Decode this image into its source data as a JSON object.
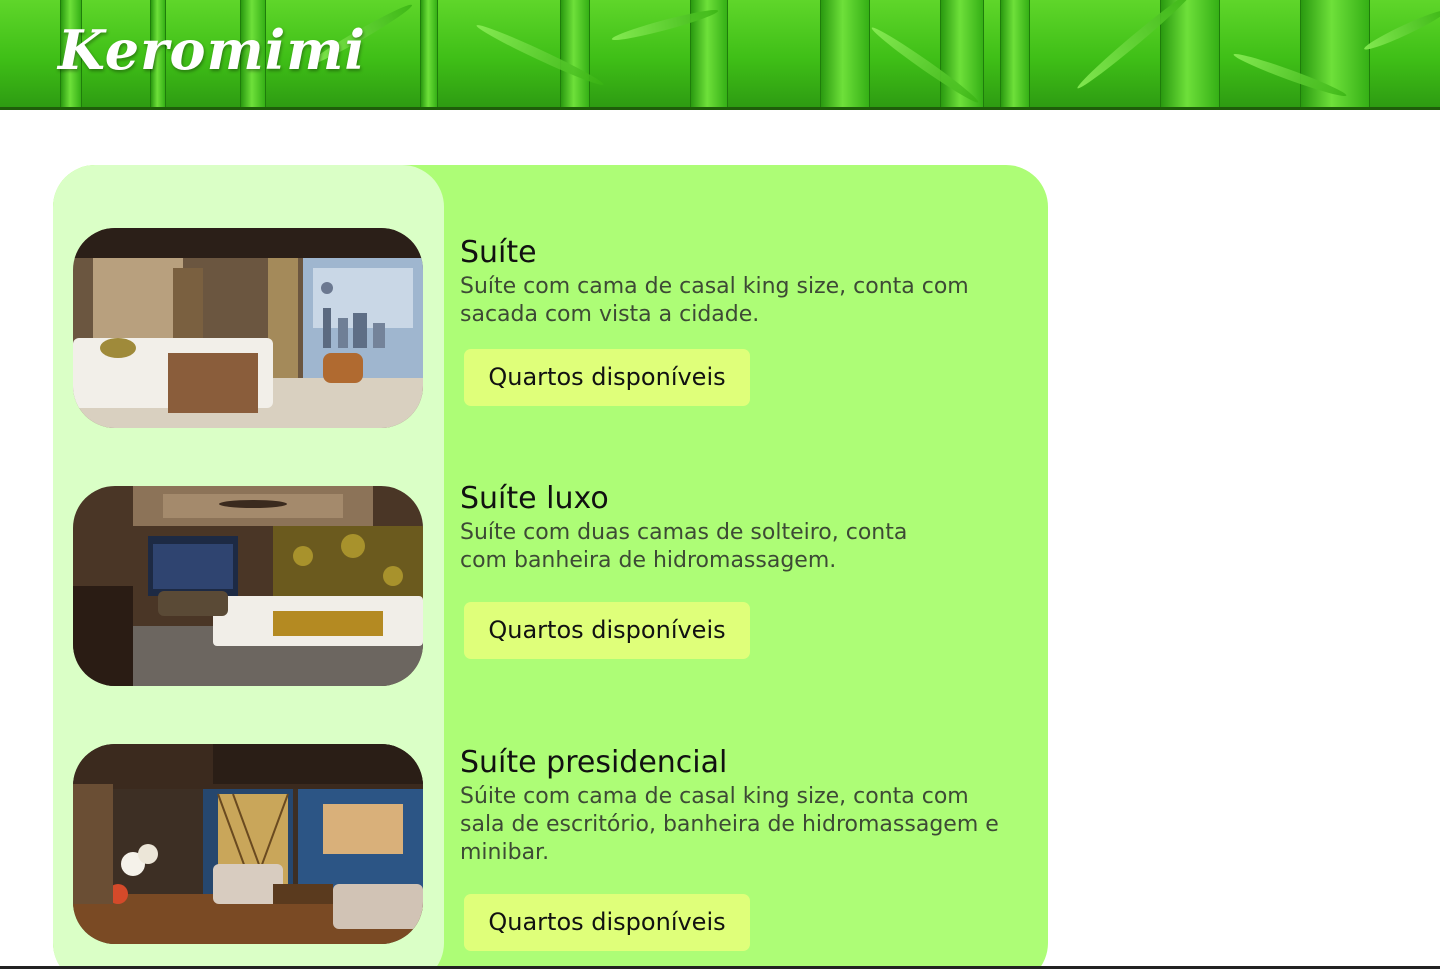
{
  "site": {
    "logo_text": "Keromimi"
  },
  "rooms": [
    {
      "title": "Suíte",
      "description": "Suíte com cama de casal king size, conta com sacada com vista a cidade.",
      "button_label": "Quartos disponíveis",
      "image_icon": "hotel-room-city-view-photo"
    },
    {
      "title": "Suíte luxo",
      "description": "Suíte com duas camas de solteiro, conta com banheira de hidromassagem.",
      "button_label": "Quartos disponíveis",
      "image_icon": "hotel-room-twin-beds-photo"
    },
    {
      "title": "Suíte presidencial",
      "description": "Súite com cama de casal king size, conta com sala de escritório, banheira de hidromassagem e minibar.",
      "button_label": "Quartos disponíveis",
      "image_icon": "hotel-suite-living-room-photo"
    }
  ],
  "colors": {
    "header_green": "#3fbf17",
    "panel_green": "#adfd76",
    "thumb_column": "#daffc6",
    "button_yellow": "#dfff7a"
  }
}
